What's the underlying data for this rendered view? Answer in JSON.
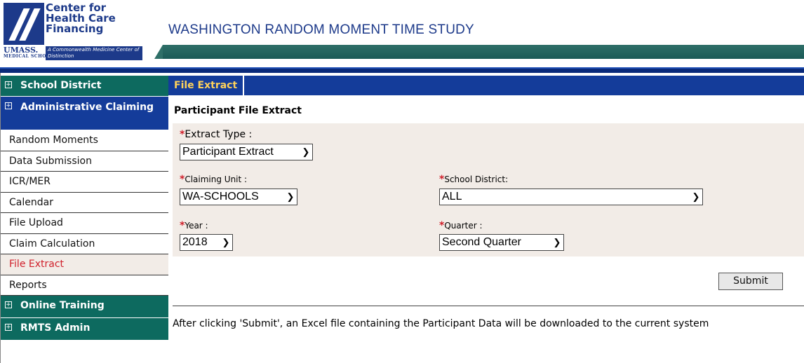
{
  "header": {
    "logo_line1": "Center for",
    "logo_line2": "Health Care",
    "logo_line3": "Financing",
    "logo_umass": "UMASS.",
    "logo_school": "MEDICAL SCHOOL",
    "logo_tag": "A Commonwealth Medicine Center of Distinction",
    "title": "WASHINGTON RANDOM MOMENT TIME STUDY"
  },
  "sidebar": {
    "sections": [
      {
        "label": "School District",
        "expander": "+"
      },
      {
        "label": "Administrative Claiming",
        "expander": "+"
      },
      {
        "label": "Online Training",
        "expander": "+"
      },
      {
        "label": "RMTS Admin",
        "expander": "+"
      }
    ],
    "items": [
      {
        "label": "Random Moments"
      },
      {
        "label": "Data Submission"
      },
      {
        "label": "ICR/MER"
      },
      {
        "label": "Calendar"
      },
      {
        "label": "File Upload"
      },
      {
        "label": "Claim Calculation"
      },
      {
        "label": "File Extract",
        "active": true
      },
      {
        "label": "Reports"
      }
    ]
  },
  "main": {
    "tab": "File Extract",
    "section_title": "Participant File Extract",
    "required_marker": "*",
    "fields": {
      "extract_type": {
        "label": "Extract Type :",
        "value": "Participant Extract"
      },
      "claiming_unit": {
        "label": "Claiming Unit :",
        "value": "WA-SCHOOLS"
      },
      "school_district": {
        "label": "School District:",
        "value": "ALL"
      },
      "year": {
        "label": "Year :",
        "value": "2018"
      },
      "quarter": {
        "label": "Quarter :",
        "value": "Second Quarter"
      }
    },
    "submit_label": "Submit",
    "note": "After clicking 'Submit', an Excel file containing the Participant Data will be downloaded to the current system"
  },
  "colors": {
    "teal": "#0d6a5f",
    "blue": "#143c9a",
    "tab_text": "#ffd25a",
    "required": "#d0202b",
    "panel": "#f2ece7"
  }
}
